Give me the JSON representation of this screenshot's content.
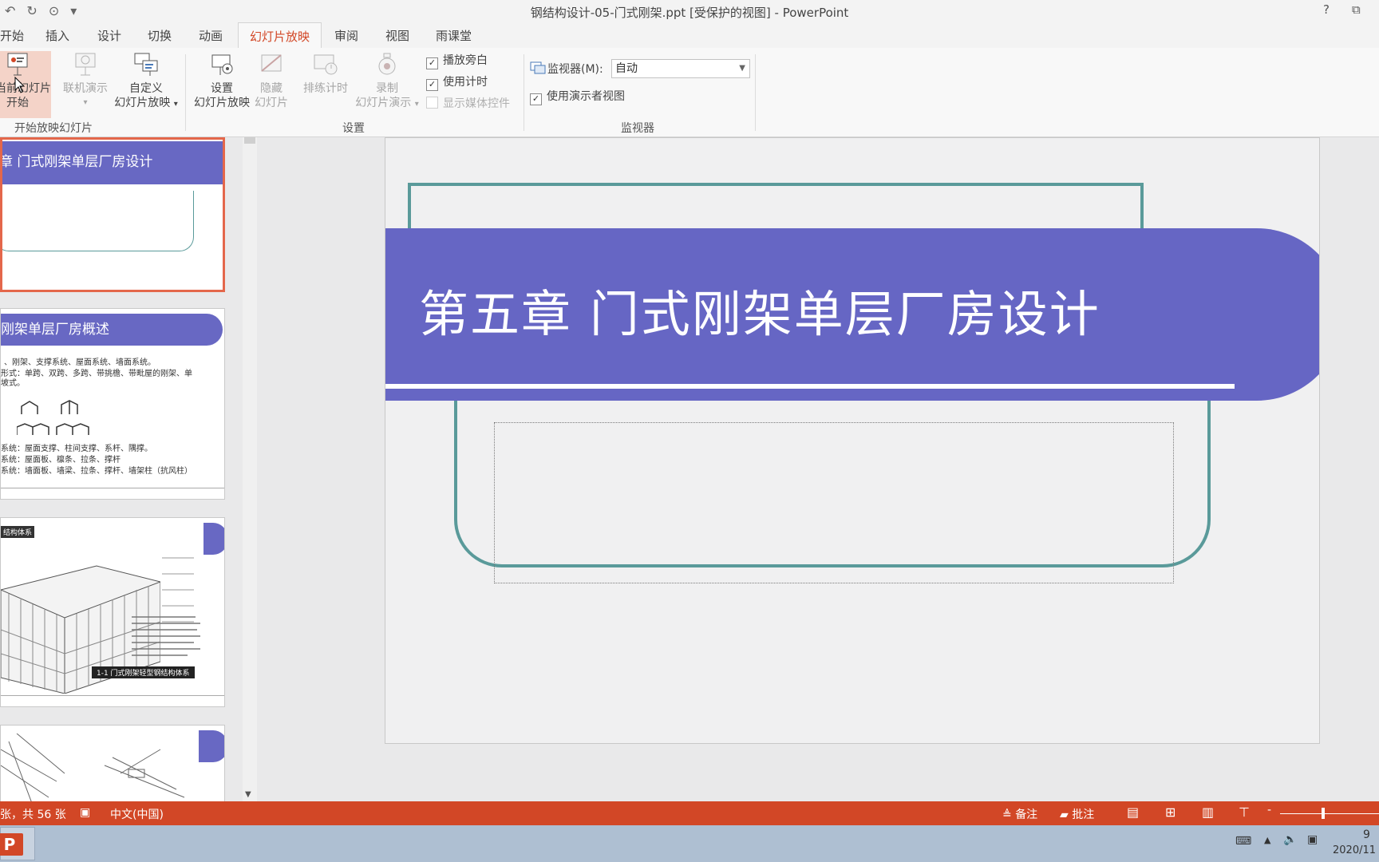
{
  "window": {
    "title": "钢结构设计-05-门式刚架.ppt [受保护的视图] - PowerPoint",
    "qat_icons": [
      "undo-icon",
      "redo-icon",
      "present-icon",
      "customize-icon"
    ],
    "help_label": "?",
    "restore_label": "⧉"
  },
  "tabs": [
    {
      "label": "开始",
      "active": false
    },
    {
      "label": "插入",
      "active": false
    },
    {
      "label": "设计",
      "active": false
    },
    {
      "label": "切换",
      "active": false
    },
    {
      "label": "动画",
      "active": false
    },
    {
      "label": "幻灯片放映",
      "active": true
    },
    {
      "label": "审阅",
      "active": false
    },
    {
      "label": "视图",
      "active": false
    },
    {
      "label": "雨课堂",
      "active": false
    }
  ],
  "ribbon": {
    "start_group": {
      "label": "开始放映幻灯片",
      "from_current": {
        "line1": "从当前幻灯片",
        "line2": "开始"
      },
      "online": {
        "line1": "联机演示",
        "line2": ""
      },
      "custom": {
        "line1": "自定义",
        "line2": "幻灯片放映"
      }
    },
    "setup_group": {
      "label": "设置",
      "setup_show": {
        "line1": "设置",
        "line2": "幻灯片放映"
      },
      "hide": {
        "line1": "隐藏",
        "line2": "幻灯片"
      },
      "rehearse": {
        "line1": "排练计时"
      },
      "record": {
        "line1": "录制",
        "line2": "幻灯片演示"
      },
      "checkboxes": [
        {
          "label": "播放旁白",
          "checked": true,
          "enabled": true
        },
        {
          "label": "使用计时",
          "checked": true,
          "enabled": true
        },
        {
          "label": "显示媒体控件",
          "checked": false,
          "enabled": false
        }
      ]
    },
    "monitor_group": {
      "label": "监视器",
      "monitor_label": "监视器(M):",
      "monitor_value": "自动",
      "presenter_view_label": "使用演示者视图",
      "presenter_view_checked": true
    }
  },
  "thumbnails": {
    "t1": {
      "title": "章 门式刚架单层厂房设计"
    },
    "t2": {
      "title": "刚架单层厂房概述",
      "lines": [
        "、刚架、支撑系统、屋面系统、墙面系统。",
        "形式：单跨、双跨、多跨、带挑檐、带毗屋的刚架、单",
        "坡式。",
        "系统：屋面支撑、柱间支撑、系杆、隅撑。",
        "系统：屋面板、檩条、拉条、撑杆",
        "系统：墙面板、墙梁、拉条、撑杆、墙架柱（抗风柱）"
      ]
    },
    "t3": {
      "label_top": "结构体系",
      "caption": "1-1  门式刚架轻型钢结构体系"
    }
  },
  "slide": {
    "title": "第五章 门式刚架单层厂房设计"
  },
  "colors": {
    "accent": "#d24726",
    "band": "#6666c4",
    "frame": "#5a9a9a"
  },
  "status": {
    "slide_info": "张，共 56 张",
    "language": "中文(中国)",
    "notes": "备注",
    "comments": "批注"
  },
  "taskbar": {
    "date": "2020/11",
    "time": "9"
  }
}
